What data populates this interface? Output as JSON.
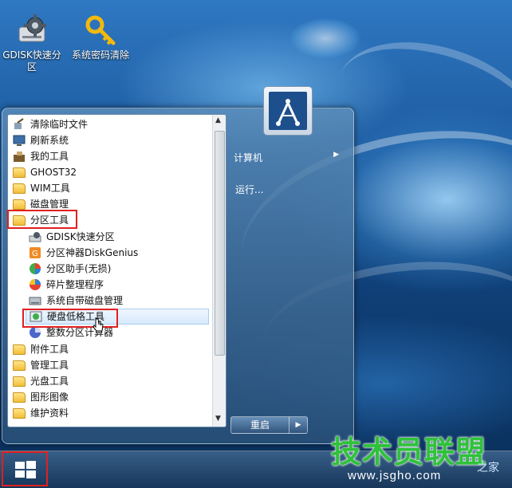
{
  "desktop": {
    "icons": [
      {
        "label": "GDISK快速分区",
        "icon": "disk-gear-icon"
      },
      {
        "label": "系统密码清除",
        "icon": "key-icon"
      }
    ]
  },
  "start_menu": {
    "programs": [
      {
        "label": "清除临时文件",
        "icon": "broom-icon"
      },
      {
        "label": "刷新系统",
        "icon": "computer-icon"
      },
      {
        "label": "我的工具",
        "icon": "tools-icon"
      },
      {
        "label": "GHOST32",
        "icon": "folder-icon"
      },
      {
        "label": "WIM工具",
        "icon": "folder-icon"
      },
      {
        "label": "磁盘管理",
        "icon": "folder-icon"
      },
      {
        "label": "分区工具",
        "icon": "folder-icon"
      },
      {
        "label": "GDISK快速分区",
        "icon": "disk-gear-icon"
      },
      {
        "label": "分区神器DiskGenius",
        "icon": "diskgenius-icon"
      },
      {
        "label": "分区助手(无损)",
        "icon": "pie-icon"
      },
      {
        "label": "碎片整理程序",
        "icon": "defrag-icon"
      },
      {
        "label": "系统自带磁盘管理",
        "icon": "disk-manage-icon"
      },
      {
        "label": "硬盘低格工具",
        "icon": "lowformat-icon"
      },
      {
        "label": "整数分区计算器",
        "icon": "calculator-icon"
      },
      {
        "label": "附件工具",
        "icon": "folder-icon"
      },
      {
        "label": "管理工具",
        "icon": "folder-icon"
      },
      {
        "label": "光盘工具",
        "icon": "folder-icon"
      },
      {
        "label": "图形图像",
        "icon": "folder-icon"
      },
      {
        "label": "维护资料",
        "icon": "folder-icon"
      }
    ],
    "right": {
      "computer_label": "计算机",
      "run_label": "运行...",
      "restart_label": "重启"
    }
  },
  "watermark": {
    "title": "技术员联盟",
    "url": "www.jsgho.com",
    "suffix": "之家"
  },
  "colors": {
    "highlight_box": "#e02020",
    "watermark_green": "#2fc23a",
    "selected_row": "#d8eafc"
  }
}
